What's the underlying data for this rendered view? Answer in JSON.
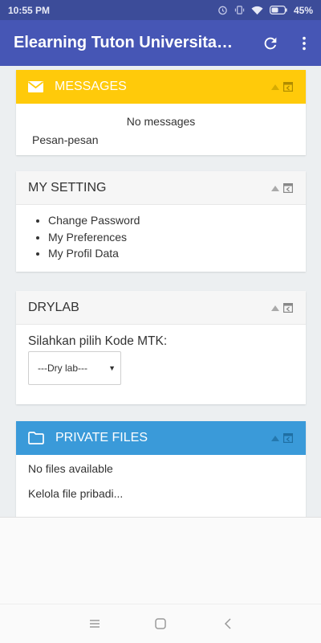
{
  "status_bar": {
    "time": "10:55 PM",
    "battery": "45%"
  },
  "app_bar": {
    "title": "Elearning Tuton Universitas T..."
  },
  "messages_block": {
    "title": "MESSAGES",
    "empty_text": "No messages",
    "link_text": "Pesan-pesan",
    "header_color": "#ffca0a"
  },
  "my_setting_block": {
    "title": "MY SETTING",
    "links": [
      "Change Password",
      "My Preferences",
      "My Profil Data"
    ]
  },
  "drylab_block": {
    "title": "DRYLAB",
    "prompt": "Silahkan pilih Kode MTK:",
    "select_value": "---Dry lab---"
  },
  "private_files_block": {
    "title": "PRIVATE FILES",
    "empty_text": "No files available",
    "manage_link": "Kelola file pribadi...",
    "header_color": "#3a9ad9"
  },
  "icons": {
    "refresh": "refresh-icon",
    "menu": "more-vert-icon",
    "messages": "envelope-icon",
    "files": "folder-icon"
  }
}
